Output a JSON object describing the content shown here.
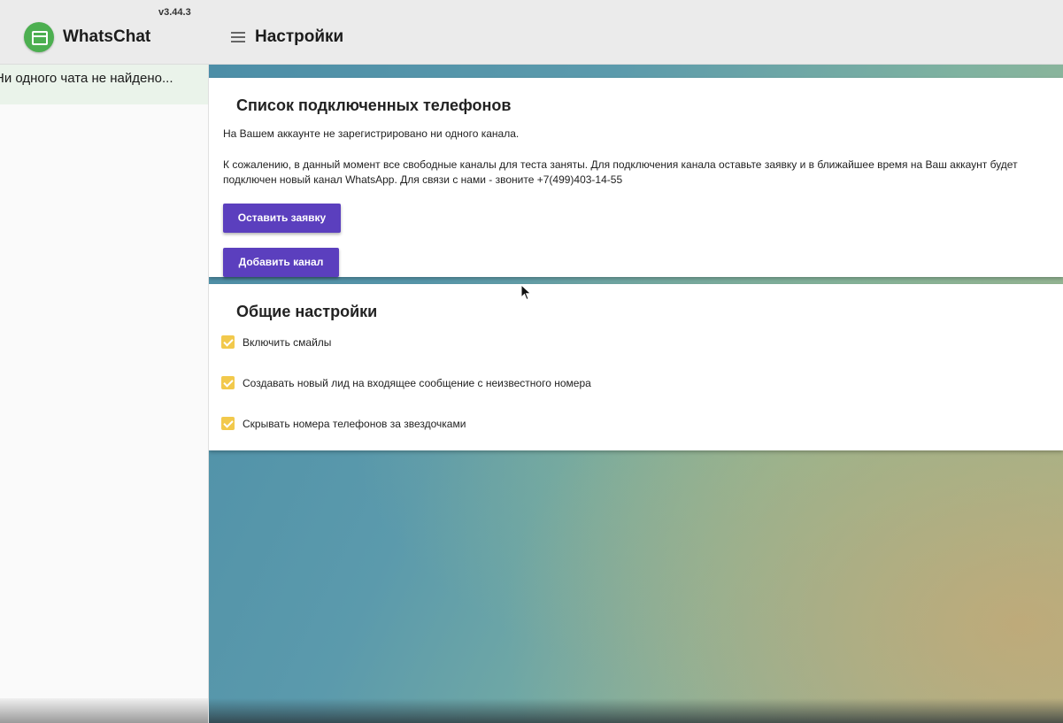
{
  "app": {
    "title": "WhatsChat",
    "version": "v3.44.3",
    "logo_icon": "chat-window-icon"
  },
  "header": {
    "menu_icon": "hamburger-menu-icon",
    "page_title": "Настройки"
  },
  "sidebar": {
    "empty_text": "Ни одного чата не найдено..."
  },
  "phones_card": {
    "title": "Список подключенных телефонов",
    "no_channels_text": "На Вашем аккаунте не зарегистрировано ни одного канала.",
    "sorry_text": "К сожалению, в данный момент все свободные каналы для теста заняты. Для подключения канала оставьте заявку и в ближайшее время на Ваш аккаунт будет подключен новый канал WhatsApp. Для связи с нами - звоните +7(499)403-14-55",
    "request_button": "Оставить заявку",
    "add_channel_button": "Добавить канал"
  },
  "general_card": {
    "title": "Общие настройки",
    "settings": [
      {
        "label": "Включить смайлы",
        "checked": true
      },
      {
        "label": "Создавать новый лид на входящее сообщение с неизвестного номера",
        "checked": true
      },
      {
        "label": "Скрывать номера телефонов за звездочками",
        "checked": true
      }
    ]
  },
  "colors": {
    "topbar": "#ebebeb",
    "logo": "#4caf50",
    "button": "#5b3fbe",
    "checkbox": "#f2c94c",
    "sidebar_highlight": "#eaf3ea"
  }
}
